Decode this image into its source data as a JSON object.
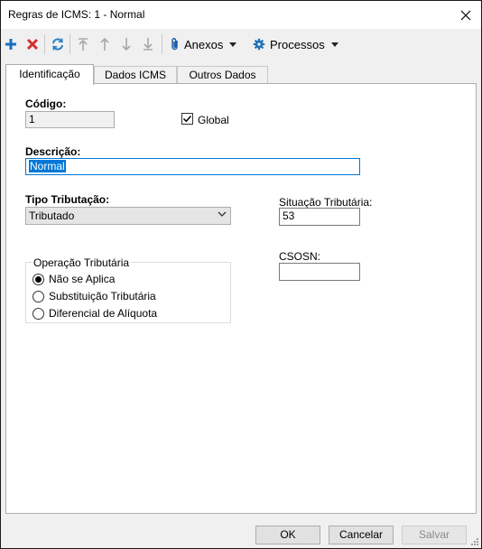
{
  "window": {
    "title": "Regras de ICMS: 1 - Normal"
  },
  "toolbar": {
    "add_icon": "plus-icon",
    "delete_icon": "x-icon",
    "refresh_icon": "refresh-icon",
    "anexos_label": "Anexos",
    "processos_label": "Processos"
  },
  "tabs": [
    {
      "label": "Identificação",
      "active": true
    },
    {
      "label": "Dados ICMS",
      "active": false
    },
    {
      "label": "Outros Dados",
      "active": false
    }
  ],
  "form": {
    "codigo_label": "Código:",
    "codigo_value": "1",
    "global_label": "Global",
    "global_checked": true,
    "descricao_label": "Descrição:",
    "descricao_value": "Normal",
    "tipo_label": "Tipo Tributação:",
    "tipo_value": "Tributado",
    "situacao_label": "Situação Tributária:",
    "situacao_value": "53",
    "csosn_label": "CSOSN:",
    "csosn_value": "",
    "operacao_legend": "Operação Tributária",
    "operacao_options": [
      "Não se Aplica",
      "Substituição Tributária",
      "Diferencial de Alíquota"
    ],
    "operacao_selected": "Não se Aplica"
  },
  "footer": {
    "ok_label": "OK",
    "cancel_label": "Cancelar",
    "save_label": "Salvar"
  },
  "colors": {
    "add": "#1a6fc4",
    "delete": "#d32f2f",
    "refresh": "#2a7fc7",
    "disabled_arrow": "#a8a8a8",
    "anexos": "#1f5fa8",
    "processos": "#1f6fb4",
    "accent": "#0078d7"
  }
}
